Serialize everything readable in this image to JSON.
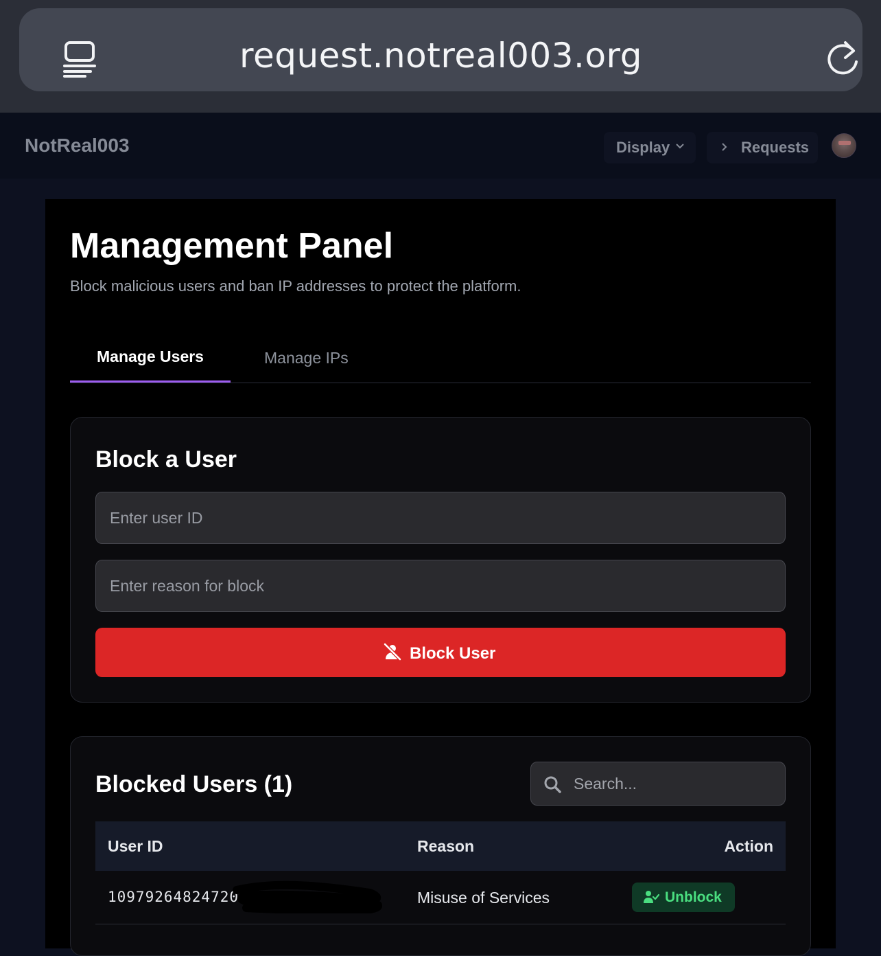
{
  "browser": {
    "url": "request.notreal003.org",
    "tabs_icon": "tab-overview-icon",
    "reload_icon": "reload-icon"
  },
  "nav": {
    "brand": "NotReal003",
    "display_label": "Display",
    "requests_label": "Requests"
  },
  "page": {
    "title": "Management Panel",
    "subtitle": "Block malicious users and ban IP addresses to protect the platform."
  },
  "tabs": [
    {
      "label": "Manage Users",
      "active": true
    },
    {
      "label": "Manage IPs",
      "active": false
    }
  ],
  "block_form": {
    "title": "Block a User",
    "user_id_placeholder": "Enter user ID",
    "reason_placeholder": "Enter reason for block",
    "button_label": "Block User"
  },
  "blocked_list": {
    "title": "Blocked Users (1)",
    "search_placeholder": "Search...",
    "columns": [
      "User ID",
      "Reason",
      "Action"
    ],
    "rows": [
      {
        "user_id": "10979264824720",
        "reason": "Misuse of Services",
        "action": "Unblock"
      }
    ]
  },
  "colors": {
    "accent": "#9d5cf0",
    "danger": "#dc2626",
    "success": "#4ade80"
  }
}
